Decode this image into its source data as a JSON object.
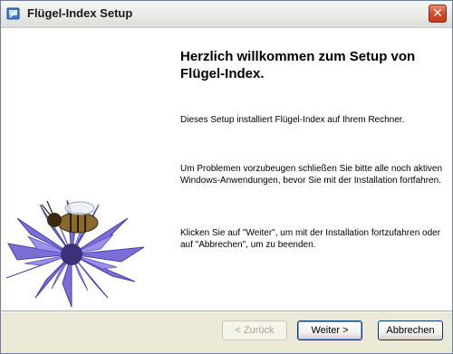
{
  "window": {
    "title": "Flügel-Index Setup",
    "icon": "installer-icon",
    "close_icon": "close-icon"
  },
  "content": {
    "heading": "Herzlich willkommen zum Setup von Flügel-Index.",
    "paragraphs": [
      "Dieses Setup installiert Flügel-Index auf Ihrem Rechner.",
      "Um Problemen vorzubeugen schließen Sie bitte alle noch aktiven Windows-Anwendungen, bevor Sie mit der Installation fortfahren.",
      "Klicken Sie auf \"Weiter\", um mit der Installation fortzufahren oder auf \"Abbrechen\", um zu beenden."
    ],
    "side_image": "bee-on-cornflower"
  },
  "buttons": {
    "back": "< Zurück",
    "next": "Weiter >",
    "cancel": "Abbrechen"
  },
  "colors": {
    "title_bar": "#ececea",
    "close_button": "#d5482a",
    "dialog_background": "#ece9d8",
    "button_border": "#003c74"
  }
}
